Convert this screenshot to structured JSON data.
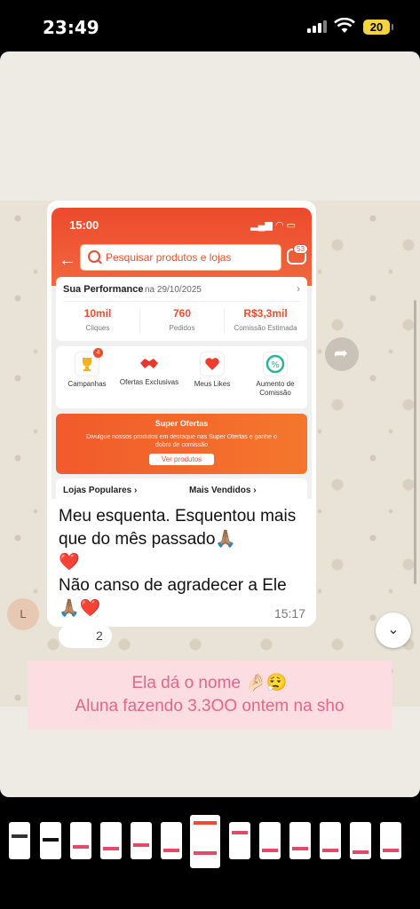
{
  "status_bar": {
    "time": "23:49",
    "battery": "20"
  },
  "screenshot": {
    "time": "15:00",
    "search_placeholder": "Pesquisar produtos e lojas",
    "chat_badge": "53",
    "performance": {
      "title": "Sua Performance",
      "date": "na 29/10/2025",
      "stats": [
        {
          "value": "10mil",
          "label": "Cliques"
        },
        {
          "value": "760",
          "label": "Pedidos"
        },
        {
          "value": "R$3,3mil",
          "label": "Comissão Estimada"
        }
      ]
    },
    "categories": [
      {
        "label": "Campanhas",
        "badge": "4"
      },
      {
        "label": "Ofertas Exclusivas"
      },
      {
        "label": "Meus Likes"
      },
      {
        "label": "Aumento de Comissão"
      }
    ],
    "super_offers": {
      "title": "Super Ofertas",
      "description": "Divulgue nossos produtos em destaque nas Super Ofertas e ganhe o dobro de comissão",
      "button": "Ver produtos"
    },
    "tabs": [
      "Lojas Populares",
      "Mais Vendidos"
    ]
  },
  "message": {
    "text_1": "Meu esquenta. Esquentou mais que do mês passado🙏🏽",
    "heart_1": "❤️",
    "text_2": "Não canso de agradecer a Ele",
    "text_3": "🙏🏽❤️",
    "time": "15:17",
    "reaction_count": "2",
    "avatar_initial": "L"
  },
  "caption": {
    "line_1": "Ela dá o nome 🤌🏻😮‍💨",
    "line_2": "Aluna fazendo 3.3OO ontem na sho"
  }
}
